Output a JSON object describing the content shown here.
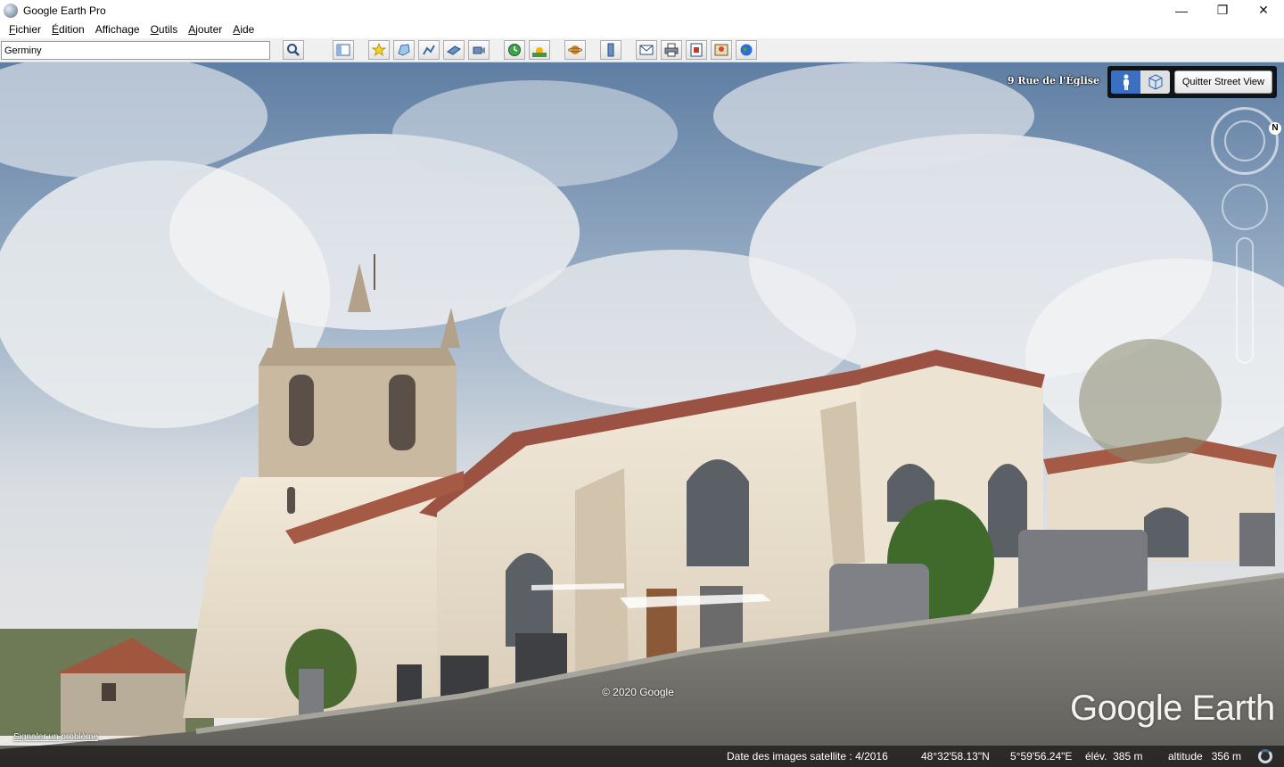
{
  "window": {
    "title": "Google Earth Pro",
    "controls": {
      "minimize": "—",
      "restore": "❐",
      "close": "✕"
    }
  },
  "menu": [
    {
      "ul": "F",
      "rest": "ichier"
    },
    {
      "ul": "É",
      "rest": "dition"
    },
    {
      "ul": "",
      "rest": "Affichage"
    },
    {
      "ul": "O",
      "rest": "utils"
    },
    {
      "ul": "A",
      "rest": "jouter"
    },
    {
      "ul": "A",
      "rest": "ide"
    }
  ],
  "toolbar": {
    "search_value": "Germiny",
    "buttons": [
      "search-icon",
      "sidebar-toggle-icon",
      "add-placemark-icon",
      "add-polygon-icon",
      "add-path-icon",
      "add-image-overlay-icon",
      "record-tour-icon",
      "historical-imagery-icon",
      "sunlight-icon",
      "switch-planet-icon",
      "ruler-icon",
      "email-icon",
      "print-icon",
      "save-image-icon",
      "view-in-maps-icon",
      "earth-icon"
    ]
  },
  "streetview": {
    "address": "9 Rue de l'Église",
    "quit_label": "Quitter Street View",
    "mode_buttons": [
      "person-view-icon",
      "cube-view-icon"
    ],
    "north_label": "N",
    "copyright": "© 2020 Google",
    "logo": "Google Earth",
    "report_link": "Signaler un problème"
  },
  "status": {
    "imagery_date": "Date des images satellite : 4/2016",
    "latitude": "48°32'58.13\"N",
    "longitude": "5°59'56.24\"E",
    "elevation": "élév.  385 m",
    "altitude": "altitude   356 m"
  },
  "colors": {
    "accent": "#3a6fc1",
    "sky_top": "#7b95b3",
    "church_wall": "#ede3d3",
    "roof": "#a55a45"
  }
}
